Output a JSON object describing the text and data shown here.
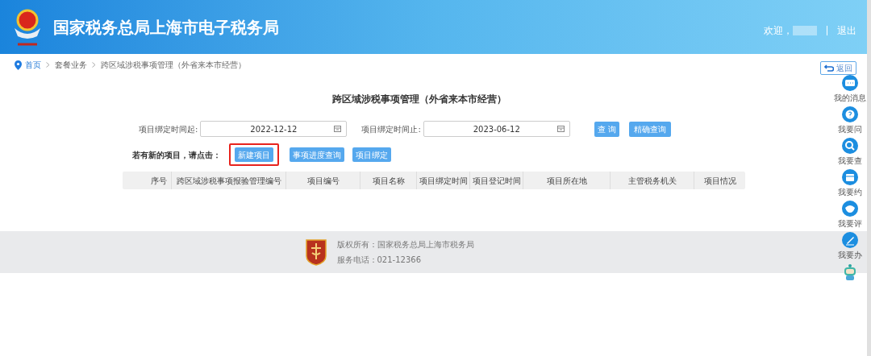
{
  "header": {
    "title": "国家税务总局上海市电子税务局",
    "welcome": "欢迎，",
    "logout": "退出"
  },
  "breadcrumb": [
    "首页",
    "套餐业务",
    "跨区域涉税事项管理（外省来本市经营）"
  ],
  "back_button": "返回",
  "page_title": "跨区域涉税事项管理（外省来本市经营）",
  "filters": [
    {
      "label": "项目绑定时间起:",
      "value": "2022-12-12"
    },
    {
      "label": "项目绑定时间止:",
      "value": "2023-06-12"
    }
  ],
  "query_buttons": [
    "查 询",
    "精确查询"
  ],
  "prompt": "若有新的项目，请点击：",
  "action_buttons": [
    {
      "label": "新建项目",
      "highlighted": true
    },
    {
      "label": "事项进度查询",
      "highlighted": false
    },
    {
      "label": "项目绑定",
      "highlighted": false
    }
  ],
  "table": {
    "columns": [
      "",
      "序号",
      "跨区域涉税事项报验管理编号",
      "项目编号",
      "项目名称",
      "项目绑定时间",
      "项目登记时间",
      "项目所在地",
      "主管税务机关",
      "项目情况"
    ]
  },
  "footer": {
    "copyright": "版权所有：国家税务总局上海市税务局",
    "phone": "服务电话：021-12366"
  },
  "sidebar": [
    {
      "kind": "message",
      "label": "我的消息"
    },
    {
      "kind": "ask",
      "label": "我要问"
    },
    {
      "kind": "search",
      "label": "我要查"
    },
    {
      "kind": "book",
      "label": "我要约"
    },
    {
      "kind": "rate",
      "label": "我要评"
    },
    {
      "kind": "do",
      "label": "我要办"
    },
    {
      "kind": "robot"
    }
  ]
}
